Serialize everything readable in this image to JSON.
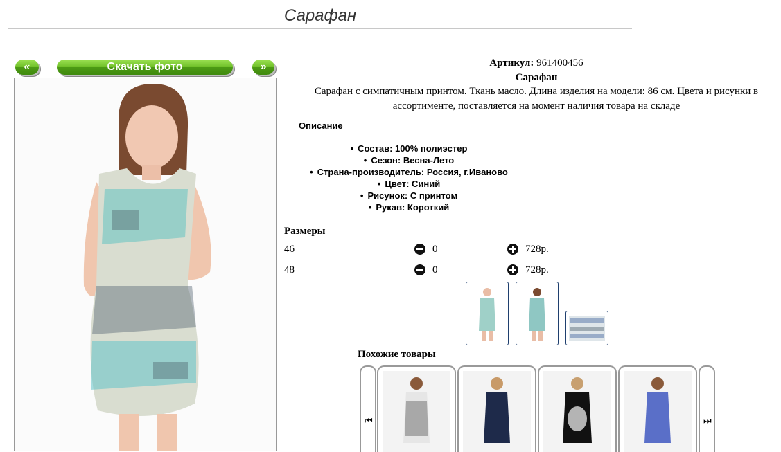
{
  "page": {
    "title": "Сарафан"
  },
  "gallery": {
    "prev_label": "«",
    "download_label": "Скачать фото",
    "next_label": "»"
  },
  "product": {
    "sku_label": "Артикул:",
    "sku": "961400456",
    "name": "Сарафан",
    "description": "Сарафан с симпатичным принтом. Ткань масло. Длина изделия на модели: 86 см. Цвета и рисунки в ассортименте, поставляется на момент наличия товара на складе"
  },
  "specs": {
    "heading": "Описание",
    "items": [
      "Состав: 100% полиэстер",
      "Сезон: Весна-Лето",
      "Страна-производитель: Россия, г.Иваново",
      "Цвет: Синий",
      "Рисунок: С принтом",
      "Рукав: Короткий"
    ]
  },
  "sizes": {
    "heading": "Размеры",
    "rows": [
      {
        "size": "46",
        "qty": "0",
        "price": "728р."
      },
      {
        "size": "48",
        "qty": "0",
        "price": "728р."
      }
    ]
  },
  "icons": {
    "minus": "minus-circle-icon",
    "plus": "plus-circle-icon",
    "carousel_prev": "skip-back-icon",
    "carousel_next": "skip-forward-icon"
  },
  "similar": {
    "heading": "Похожие товары"
  },
  "colors": {
    "button_green": "#4d9a14",
    "thumb_border": "#1f3f6e"
  }
}
